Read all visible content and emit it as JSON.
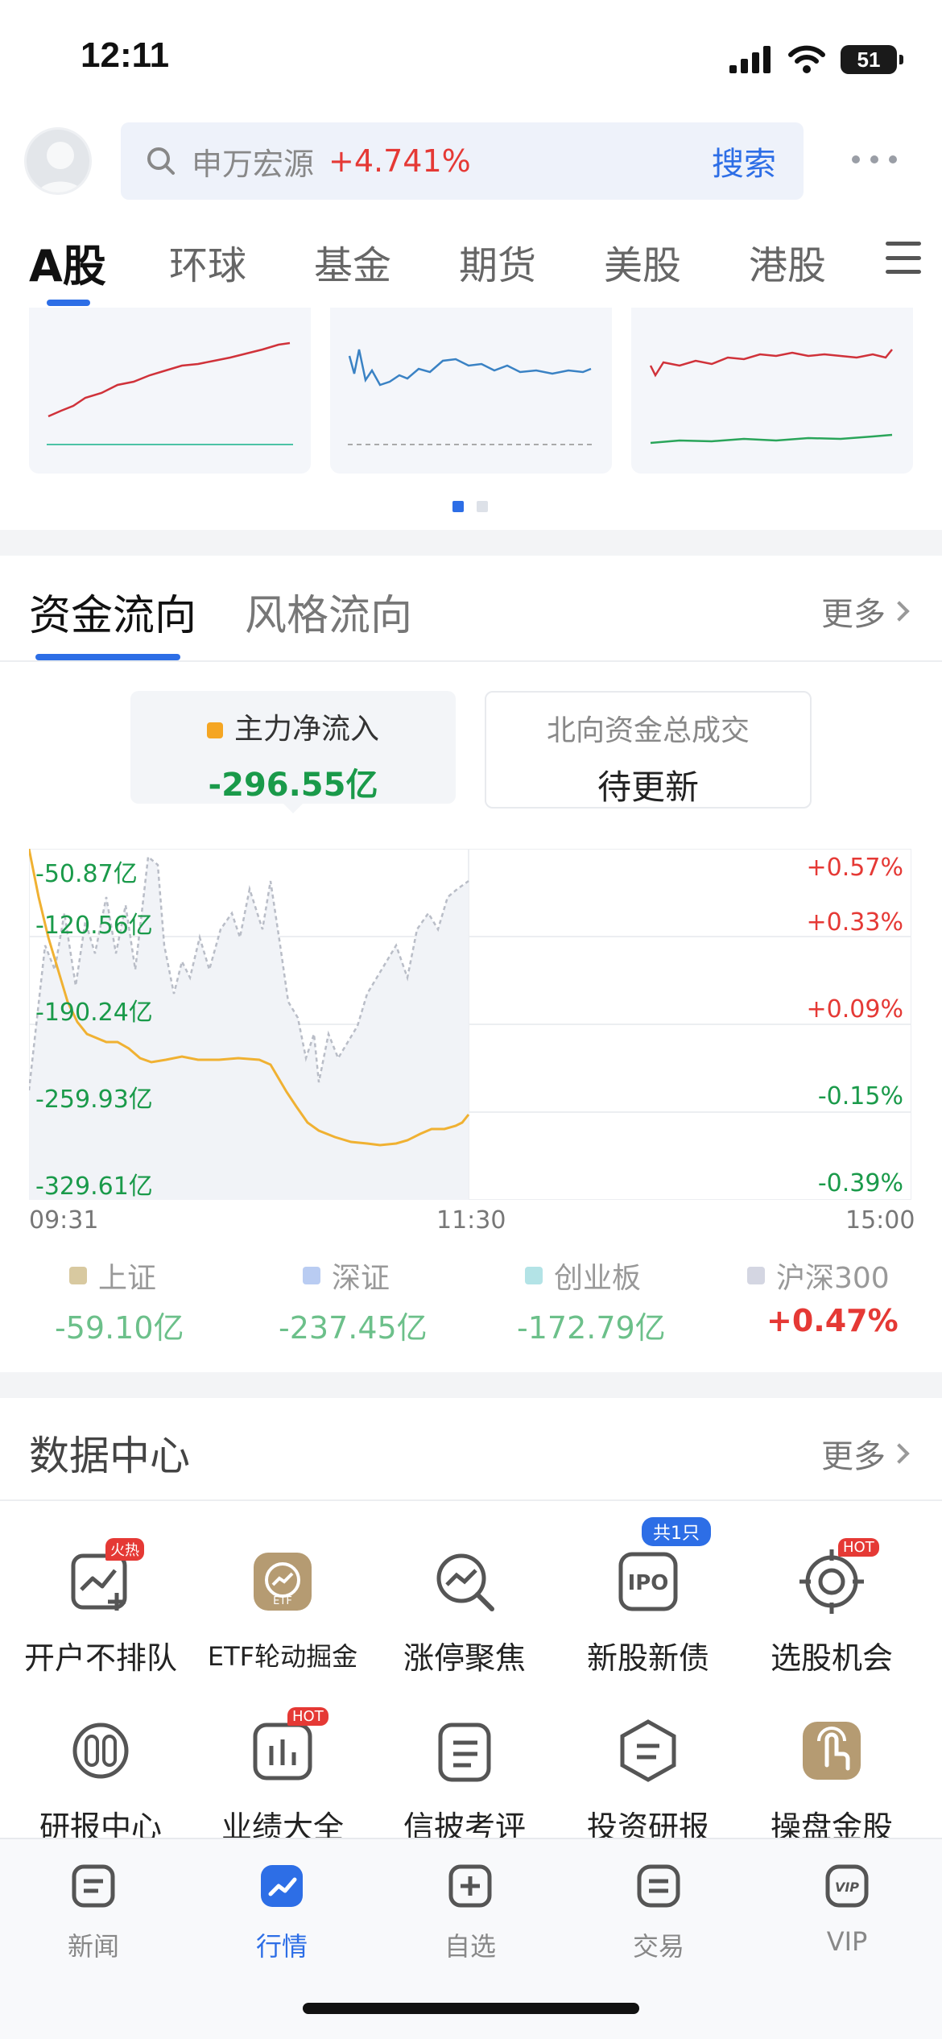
{
  "status_bar": {
    "time": "12:11",
    "battery": "51"
  },
  "header": {
    "search_name": "申万宏源",
    "search_change": "+4.741%",
    "search_button": "搜索"
  },
  "nav_tabs": [
    "A股",
    "环球",
    "基金",
    "期货",
    "美股",
    "港股"
  ],
  "flow_section": {
    "tabs": [
      "资金流向",
      "风格流向"
    ],
    "more": "更多",
    "main_inflow_label": "主力净流入",
    "main_inflow_value": "-296.55亿",
    "north_label": "北向资金总成交",
    "north_value": "待更新",
    "y_left_labels": [
      "-50.87亿",
      "-120.56亿",
      "-190.24亿",
      "-259.93亿",
      "-329.61亿"
    ],
    "y_right_labels": [
      "+0.57%",
      "+0.33%",
      "+0.09%",
      "-0.15%",
      "-0.39%"
    ],
    "time_labels": [
      "09:31",
      "11:30",
      "15:00"
    ],
    "indices": [
      {
        "name": "上证",
        "value": "-59.10亿",
        "color": "#d8c9a0"
      },
      {
        "name": "深证",
        "value": "-237.45亿",
        "color": "#b9ccf2"
      },
      {
        "name": "创业板",
        "value": "-172.79亿",
        "color": "#b3e3e6"
      },
      {
        "name": "沪深300",
        "value": "+0.47%",
        "color": "#d4d6e2"
      }
    ]
  },
  "data_center": {
    "title": "数据中心",
    "more": "更多",
    "items": [
      {
        "label": "开户不排队",
        "badge": "火热",
        "icon": "chart-plus-icon"
      },
      {
        "label": "ETF轮动掘金",
        "badge": "",
        "icon": "etf-icon"
      },
      {
        "label": "涨停聚焦",
        "badge": "",
        "icon": "magnifier-chart-icon"
      },
      {
        "label": "新股新债",
        "badge": "共1只",
        "icon": "ipo-icon"
      },
      {
        "label": "选股机会",
        "badge": "HOT",
        "icon": "target-icon"
      },
      {
        "label": "研报中心",
        "badge": "",
        "icon": "report-icon"
      },
      {
        "label": "业绩大全",
        "badge": "HOT",
        "icon": "bar-chart-icon"
      },
      {
        "label": "信披考评",
        "badge": "",
        "icon": "clipboard-icon"
      },
      {
        "label": "投资研报",
        "badge": "",
        "icon": "document-shield-icon"
      },
      {
        "label": "操盘金股",
        "badge": "",
        "icon": "finger-touch-icon"
      }
    ]
  },
  "bottom_nav": [
    "新闻",
    "行情",
    "自选",
    "交易",
    "VIP"
  ],
  "colors": {
    "accent": "#2d6ee6",
    "up": "#e53935",
    "down": "#1a9a4a",
    "main_line": "#f0b132"
  }
}
